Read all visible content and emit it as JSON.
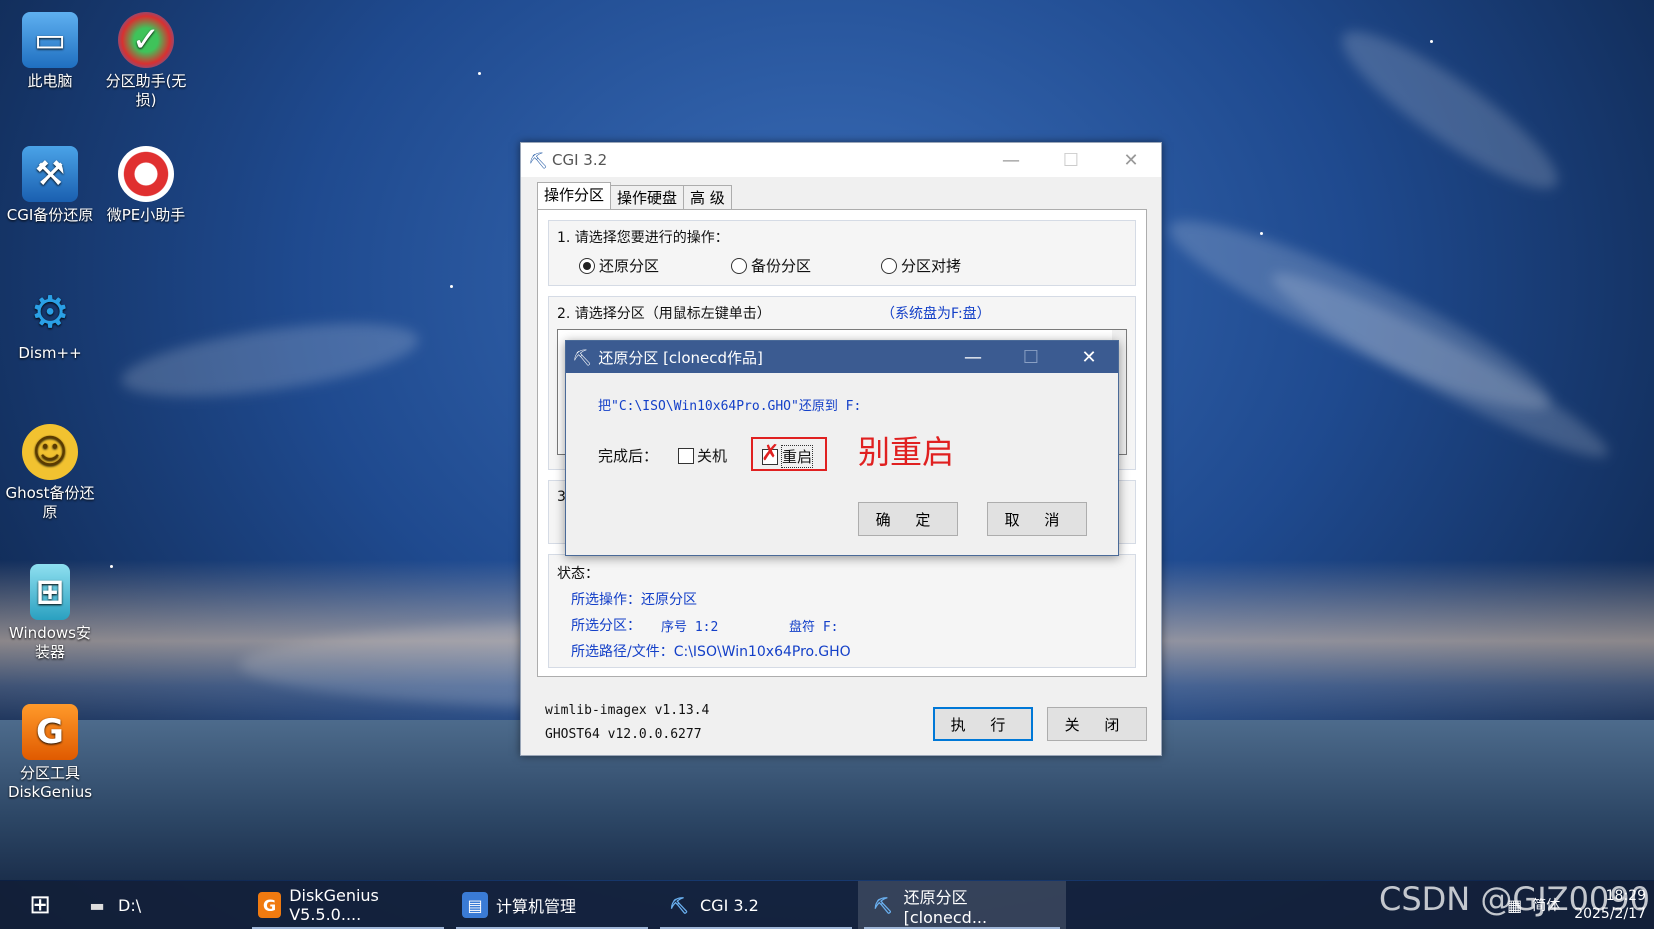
{
  "desktop": {
    "icons": [
      {
        "label": "此电脑",
        "icon": "computer-icon"
      },
      {
        "label": "分区助手(无损)",
        "icon": "partition-assistant-icon"
      },
      {
        "label": "CGI备份还原",
        "icon": "cgi-backup-icon"
      },
      {
        "label": "微PE小助手",
        "icon": "lifebuoy-icon"
      },
      {
        "label": "Dism++",
        "icon": "gears-icon"
      },
      {
        "label": "Ghost备份还原",
        "icon": "ghost-icon"
      },
      {
        "label": "Windows安装器",
        "icon": "windows-installer-icon"
      },
      {
        "label": "分区工具DiskGenius",
        "icon": "diskgenius-icon"
      }
    ]
  },
  "main_window": {
    "title": "CGI 3.2",
    "tabs": [
      "操作分区",
      "操作硬盘",
      "高 级"
    ],
    "step1_label": "1. 请选择您要进行的操作：",
    "operations": [
      {
        "label": "还原分区",
        "selected": true
      },
      {
        "label": "备份分区",
        "selected": false
      },
      {
        "label": "分区对拷",
        "selected": false
      }
    ],
    "step2_label": "2. 请选择分区（用鼠标左键单击）",
    "system_drive_note": "（系统盘为F:盘）",
    "step3_fragment": "3",
    "status": {
      "heading": "状态：",
      "operation": "所选操作：还原分区",
      "partition_label": "所选分区：",
      "sequence": "序号 1:2",
      "drive_letter": "盘符 F:",
      "path": "所选路径/文件：C:\\ISO\\Win10x64Pro.GHO"
    },
    "version_wimlib": "wimlib-imagex v1.13.4",
    "version_ghost": "GHOST64 v12.0.0.6277",
    "execute_button": "执 行",
    "close_button": "关 闭"
  },
  "dialog": {
    "title": "还原分区 [clonecd作品]",
    "message": "把\"C:\\ISO\\Win10x64Pro.GHO\"还原到 F:",
    "after_label": "完成后：",
    "shutdown_label": "关机",
    "shutdown_checked": false,
    "restart_label": "重启",
    "restart_checked": false,
    "annotation": "别重启",
    "annotation_color": "#e02020",
    "ok_button": "确 定",
    "cancel_button": "取 消"
  },
  "taskbar": {
    "start": "windows-start-icon",
    "items": [
      {
        "label": "D:\\",
        "icon": "drive-icon"
      },
      {
        "label": "DiskGenius V5.5.0....",
        "icon": "diskgenius-icon"
      },
      {
        "label": "计算机管理",
        "icon": "computer-management-icon"
      },
      {
        "label": "CGI 3.2",
        "icon": "cgi-icon"
      },
      {
        "label": "还原分区 [clonecd...",
        "icon": "cgi-icon"
      }
    ],
    "tray_ime": "简体",
    "time": "18:29",
    "date": "2025/2/17"
  },
  "watermark": "CSDN @GJZ0090"
}
